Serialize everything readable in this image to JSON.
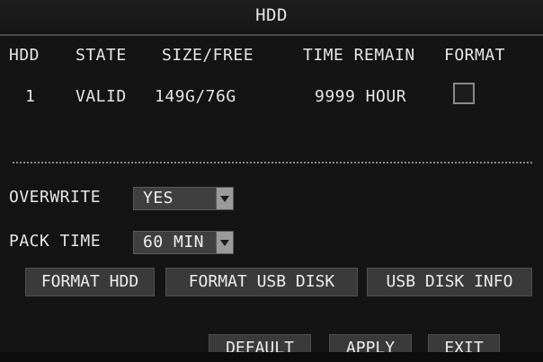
{
  "window": {
    "title": "HDD"
  },
  "table": {
    "headers": {
      "hdd": "HDD",
      "state": "STATE",
      "size_free": "SIZE/FREE",
      "time_remain": "TIME REMAIN",
      "format": "FORMAT"
    },
    "rows": [
      {
        "hdd": "1",
        "state": "VALID",
        "size_free": "149G/76G",
        "time_remain": "9999 HOUR",
        "format_checked": false
      }
    ]
  },
  "settings": {
    "overwrite": {
      "label": "OVERWRITE",
      "value": "YES"
    },
    "pack_time": {
      "label": "PACK TIME",
      "value": "60 MIN"
    }
  },
  "actions": {
    "format_hdd": "FORMAT HDD",
    "format_usb_disk": "FORMAT USB DISK",
    "usb_disk_info": "USB DISK INFO"
  },
  "footer": {
    "default": "DEFAULT",
    "apply": "APPLY",
    "exit": "EXIT"
  },
  "colors": {
    "background": "#141414",
    "text": "#e6e6e6",
    "button": "#3a3a3a",
    "dropdown_arrow": "#9a9a9a"
  }
}
